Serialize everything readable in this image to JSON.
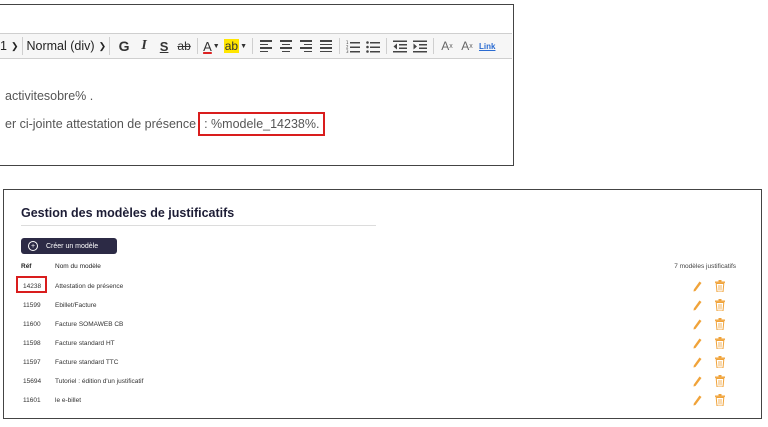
{
  "editor": {
    "font_size_value": "1",
    "format_value": "Normal (div)",
    "toolbar": {
      "bold": "G",
      "italic": "I",
      "underline": "S",
      "strike": "ab",
      "font_color": "A",
      "highlight": "ab",
      "superscript": "A",
      "superscript_mark": "x",
      "subscript": "A",
      "subscript_mark": "x",
      "link": "Link"
    },
    "line1": "activitesobre% .",
    "line2_prefix": "er ci-jointe attestation de présence",
    "line2_highlight": ": %modele_14238%."
  },
  "gestion": {
    "title": "Gestion des modèles de justificatifs",
    "create_button": "Créer un modèle",
    "col_ref": "Réf",
    "col_name": "Nom du modèle",
    "count_label": "7 modèles justificatifs",
    "rows": [
      {
        "ref": "14238",
        "name": "Attestation de présence"
      },
      {
        "ref": "11599",
        "name": "Ebillet/Facture"
      },
      {
        "ref": "11600",
        "name": "Facture SOMAWEB CB"
      },
      {
        "ref": "11598",
        "name": "Facture standard HT"
      },
      {
        "ref": "11597",
        "name": "Facture standard TTC"
      },
      {
        "ref": "15694",
        "name": "Tutoriel : édition d'un justificatif"
      },
      {
        "ref": "11601",
        "name": "le e-billet"
      }
    ]
  },
  "colors": {
    "highlight_border": "#d91d1d",
    "create_button_bg": "#2c2a45",
    "icon_orange": "#f0a33a"
  },
  "icons": {
    "edit": "pencil-icon",
    "delete": "trash-icon",
    "create": "plus-circle-icon"
  }
}
